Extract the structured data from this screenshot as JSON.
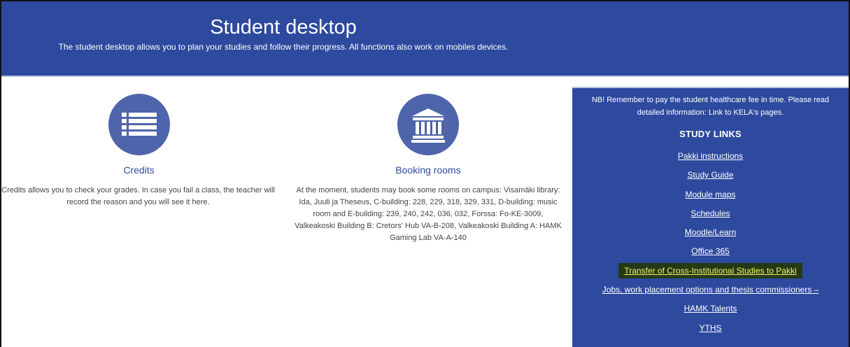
{
  "header": {
    "title": "Student desktop",
    "subtitle": "The student desktop allows you to plan your studies and follow their progress. All functions also work on mobiles devices."
  },
  "cards": {
    "credits": {
      "icon": "list-icon",
      "heading": "Credits",
      "text": "Credits allows you to check your grades. In case you fail a class, the teacher will record the reason and you will see it here."
    },
    "booking": {
      "icon": "building-icon",
      "heading": "Booking rooms",
      "text": "At the moment, students may book some rooms on campus: Visamäki library: Ida, Juuli ja Theseus, C-building: 228, 229, 318, 329, 331, D-building: music room and E-building: 239, 240, 242, 036, 032, Forssa: Fo-KE-3009, Valkeakoski Building B: Cretors' Hub VA-B-208, Valkeakoski Building A: HAMK Gaming Lab VA-A-140"
    }
  },
  "sidebar": {
    "notice": "NB! Remember to pay the student healthcare fee in time. Please read detailed information: Link to KELA's pages.",
    "links_title": "STUDY LINKS",
    "links": [
      {
        "label": "Pakki instructions"
      },
      {
        "label": "Study Guide"
      },
      {
        "label": "Module maps"
      },
      {
        "label": "Schedules"
      },
      {
        "label": "Moodle/Learn"
      },
      {
        "label": "Office 365"
      },
      {
        "label": "Transfer of Cross-Institutional Studies to Pakki"
      },
      {
        "label": "Jobs, work placement options and thesis commissioners –"
      },
      {
        "label": "HAMK Talents"
      },
      {
        "label": "YTHS"
      }
    ]
  },
  "colors": {
    "brand": "#2e4a9e",
    "icon_circle": "#4e64ab",
    "highlight_bg": "#243a17",
    "highlight_text": "#f3f36a"
  }
}
